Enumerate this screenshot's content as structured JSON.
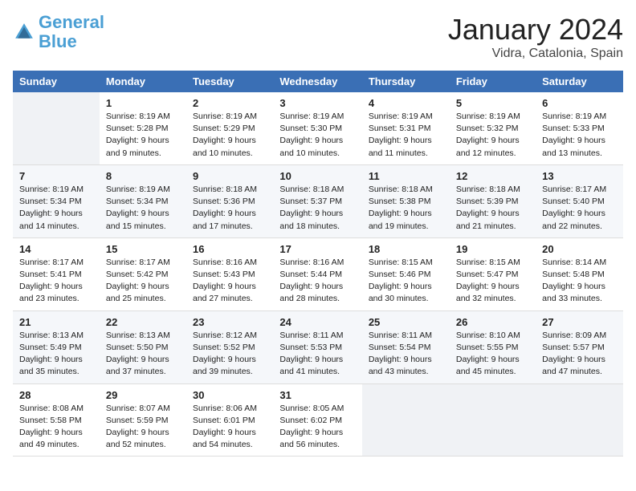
{
  "header": {
    "logo_line1": "General",
    "logo_line2": "Blue",
    "title": "January 2024",
    "subtitle": "Vidra, Catalonia, Spain"
  },
  "days_of_week": [
    "Sunday",
    "Monday",
    "Tuesday",
    "Wednesday",
    "Thursday",
    "Friday",
    "Saturday"
  ],
  "weeks": [
    [
      {
        "num": "",
        "info": ""
      },
      {
        "num": "1",
        "info": "Sunrise: 8:19 AM\nSunset: 5:28 PM\nDaylight: 9 hours\nand 9 minutes."
      },
      {
        "num": "2",
        "info": "Sunrise: 8:19 AM\nSunset: 5:29 PM\nDaylight: 9 hours\nand 10 minutes."
      },
      {
        "num": "3",
        "info": "Sunrise: 8:19 AM\nSunset: 5:30 PM\nDaylight: 9 hours\nand 10 minutes."
      },
      {
        "num": "4",
        "info": "Sunrise: 8:19 AM\nSunset: 5:31 PM\nDaylight: 9 hours\nand 11 minutes."
      },
      {
        "num": "5",
        "info": "Sunrise: 8:19 AM\nSunset: 5:32 PM\nDaylight: 9 hours\nand 12 minutes."
      },
      {
        "num": "6",
        "info": "Sunrise: 8:19 AM\nSunset: 5:33 PM\nDaylight: 9 hours\nand 13 minutes."
      }
    ],
    [
      {
        "num": "7",
        "info": "Sunrise: 8:19 AM\nSunset: 5:34 PM\nDaylight: 9 hours\nand 14 minutes."
      },
      {
        "num": "8",
        "info": "Sunrise: 8:19 AM\nSunset: 5:34 PM\nDaylight: 9 hours\nand 15 minutes."
      },
      {
        "num": "9",
        "info": "Sunrise: 8:18 AM\nSunset: 5:36 PM\nDaylight: 9 hours\nand 17 minutes."
      },
      {
        "num": "10",
        "info": "Sunrise: 8:18 AM\nSunset: 5:37 PM\nDaylight: 9 hours\nand 18 minutes."
      },
      {
        "num": "11",
        "info": "Sunrise: 8:18 AM\nSunset: 5:38 PM\nDaylight: 9 hours\nand 19 minutes."
      },
      {
        "num": "12",
        "info": "Sunrise: 8:18 AM\nSunset: 5:39 PM\nDaylight: 9 hours\nand 21 minutes."
      },
      {
        "num": "13",
        "info": "Sunrise: 8:17 AM\nSunset: 5:40 PM\nDaylight: 9 hours\nand 22 minutes."
      }
    ],
    [
      {
        "num": "14",
        "info": "Sunrise: 8:17 AM\nSunset: 5:41 PM\nDaylight: 9 hours\nand 23 minutes."
      },
      {
        "num": "15",
        "info": "Sunrise: 8:17 AM\nSunset: 5:42 PM\nDaylight: 9 hours\nand 25 minutes."
      },
      {
        "num": "16",
        "info": "Sunrise: 8:16 AM\nSunset: 5:43 PM\nDaylight: 9 hours\nand 27 minutes."
      },
      {
        "num": "17",
        "info": "Sunrise: 8:16 AM\nSunset: 5:44 PM\nDaylight: 9 hours\nand 28 minutes."
      },
      {
        "num": "18",
        "info": "Sunrise: 8:15 AM\nSunset: 5:46 PM\nDaylight: 9 hours\nand 30 minutes."
      },
      {
        "num": "19",
        "info": "Sunrise: 8:15 AM\nSunset: 5:47 PM\nDaylight: 9 hours\nand 32 minutes."
      },
      {
        "num": "20",
        "info": "Sunrise: 8:14 AM\nSunset: 5:48 PM\nDaylight: 9 hours\nand 33 minutes."
      }
    ],
    [
      {
        "num": "21",
        "info": "Sunrise: 8:13 AM\nSunset: 5:49 PM\nDaylight: 9 hours\nand 35 minutes."
      },
      {
        "num": "22",
        "info": "Sunrise: 8:13 AM\nSunset: 5:50 PM\nDaylight: 9 hours\nand 37 minutes."
      },
      {
        "num": "23",
        "info": "Sunrise: 8:12 AM\nSunset: 5:52 PM\nDaylight: 9 hours\nand 39 minutes."
      },
      {
        "num": "24",
        "info": "Sunrise: 8:11 AM\nSunset: 5:53 PM\nDaylight: 9 hours\nand 41 minutes."
      },
      {
        "num": "25",
        "info": "Sunrise: 8:11 AM\nSunset: 5:54 PM\nDaylight: 9 hours\nand 43 minutes."
      },
      {
        "num": "26",
        "info": "Sunrise: 8:10 AM\nSunset: 5:55 PM\nDaylight: 9 hours\nand 45 minutes."
      },
      {
        "num": "27",
        "info": "Sunrise: 8:09 AM\nSunset: 5:57 PM\nDaylight: 9 hours\nand 47 minutes."
      }
    ],
    [
      {
        "num": "28",
        "info": "Sunrise: 8:08 AM\nSunset: 5:58 PM\nDaylight: 9 hours\nand 49 minutes."
      },
      {
        "num": "29",
        "info": "Sunrise: 8:07 AM\nSunset: 5:59 PM\nDaylight: 9 hours\nand 52 minutes."
      },
      {
        "num": "30",
        "info": "Sunrise: 8:06 AM\nSunset: 6:01 PM\nDaylight: 9 hours\nand 54 minutes."
      },
      {
        "num": "31",
        "info": "Sunrise: 8:05 AM\nSunset: 6:02 PM\nDaylight: 9 hours\nand 56 minutes."
      },
      {
        "num": "",
        "info": ""
      },
      {
        "num": "",
        "info": ""
      },
      {
        "num": "",
        "info": ""
      }
    ]
  ]
}
